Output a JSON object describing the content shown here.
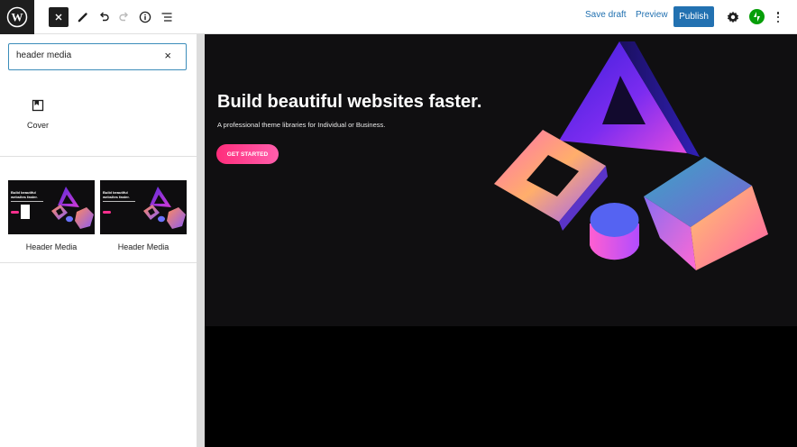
{
  "toolbar": {
    "save_draft": "Save draft",
    "preview": "Preview",
    "publish": "Publish",
    "icons": [
      "wordpress-logo-icon",
      "close-icon",
      "pencil-icon",
      "undo-icon",
      "redo-icon",
      "info-icon",
      "list-view-icon",
      "settings-gear-icon",
      "jetpack-icon",
      "more-options-icon"
    ]
  },
  "inserter": {
    "search_value": "header media",
    "blocks": [
      {
        "label": "Cover",
        "icon": "cover-block-icon"
      }
    ],
    "patterns": [
      {
        "label": "Header Media",
        "thumb_title": "Build beautiful websites faster."
      },
      {
        "label": "Header Media",
        "thumb_title": "Build beautiful websites faster."
      }
    ]
  },
  "hero": {
    "title": "Build beautiful websites faster.",
    "subtitle": "A professional theme libraries for Individual or Business.",
    "button": "GET STARTED"
  },
  "colors": {
    "accent": "#2271b1",
    "hero_bg": "#100f11",
    "button_pink": "#ff2d7b",
    "jetpack_green": "#069e08"
  }
}
